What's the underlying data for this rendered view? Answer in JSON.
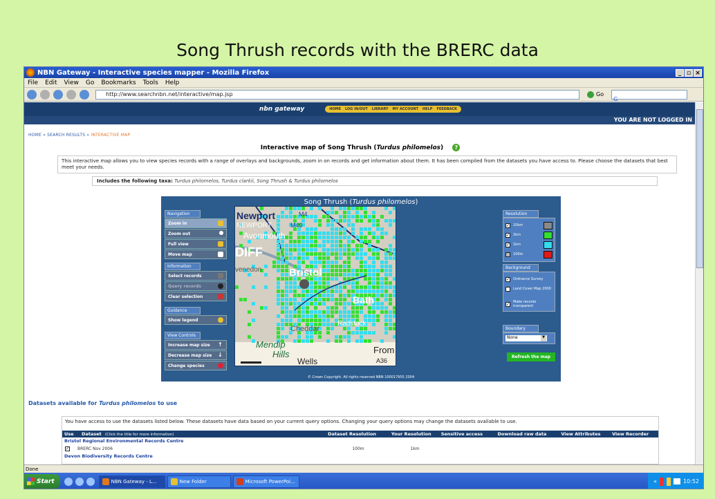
{
  "slide": {
    "title": "Song Thrush records with the BRERC data"
  },
  "window": {
    "title": "NBN Gateway - Interactive species mapper - Mozilla Firefox",
    "controls": [
      "_",
      "×"
    ],
    "menu": [
      "File",
      "Edit",
      "View",
      "Go",
      "Bookmarks",
      "Tools",
      "Help"
    ],
    "url": "http://www.searchnbn.net/interactive/map.jsp",
    "go_label": "Go",
    "search_label": "G"
  },
  "site": {
    "brand": "nbn gateway",
    "nav": [
      "HOME",
      "LOG IN/OUT",
      "LIBRARY",
      "MY ACCOUNT",
      "HELP",
      "FEEDBACK"
    ],
    "login_status": "YOU ARE NOT LOGGED IN"
  },
  "breadcrumb": {
    "home": "HOME",
    "results": "SEARCH RESULTS",
    "current": "INTERACTIVE MAP",
    "sep": " » "
  },
  "page": {
    "heading_prefix": "Interactive map of Song Thrush (",
    "heading_latin": "Turdus philomelos",
    "heading_suffix": ")",
    "help": "?",
    "description": "This interactive map allows you to view species records with a range of overlays and backgrounds, zoom in on records and get information about them. It has been compiled from the datasets you have access to. Please choose the datasets that best meet your needs.",
    "taxa_label": "Includes the following taxa:",
    "taxa_value": "Turdus philomelos, Turdus clarkii, Song Thrush & Turdus philomelos"
  },
  "map": {
    "title_common": "Song Thrush (",
    "title_latin": "Turdus philomelos",
    "title_close": ")",
    "footer": "© Crown Copyright. All rights reserved NBN 100017955 2004",
    "places": [
      "Newport",
      "NEWPORT",
      "M4",
      "M49",
      "Avonmouth",
      "DIFF",
      "venedon",
      "Bristol",
      "Bath",
      "Radstock",
      "Cheddar",
      "Mendip",
      "Hills",
      "Wells",
      "From",
      "A36"
    ],
    "groups": {
      "navigation": {
        "label": "Navigation",
        "buttons": [
          "Zoom in",
          "Zoom out",
          "Full view",
          "Move map"
        ]
      },
      "information": {
        "label": "Information",
        "buttons": [
          "Select records",
          "Query records",
          "Clear selection"
        ]
      },
      "guidance": {
        "label": "Guidance",
        "buttons": [
          "Show legend"
        ]
      },
      "view": {
        "label": "View Controls",
        "buttons": [
          "Increase map size",
          "Decrease map size",
          "Change species"
        ]
      }
    },
    "resolution": {
      "label": "Resolution",
      "rows": [
        {
          "label": "10km",
          "color": "#8a8a8a"
        },
        {
          "label": "2km",
          "color": "#33e033"
        },
        {
          "label": "1km",
          "color": "#33ddf0"
        },
        {
          "label": "100m",
          "color": "#e01818"
        }
      ]
    },
    "background": {
      "label": "Background",
      "rows": [
        "Ordnance Survey",
        "Land Cover Map 2000",
        "Make records transparent"
      ]
    },
    "boundary": {
      "label": "Boundary",
      "value": "None"
    },
    "refresh": "Refresh the map"
  },
  "datasets": {
    "heading_prefix": "Datasets available for ",
    "heading_latin": "Turdus philomelos",
    "heading_suffix": " to use",
    "note": "You have access to use the datasets listed below. These datasets have data based on your current query options. Changing your query options may change the datasets available to use.",
    "columns": [
      "Use",
      "Dataset",
      "Dataset Resolution",
      "Your Resolution",
      "Sensitive access",
      "Download raw data",
      "View Attributes",
      "View Recorder"
    ],
    "column_hint": "(Click the title for more information)",
    "providers": [
      {
        "name": "Bristol Regional Environmental Records Centre",
        "rows": [
          {
            "dataset": "BRERC Nov 2006",
            "dataset_res": "100m",
            "your_res": "1km"
          }
        ]
      },
      {
        "name": "Devon Biodiversity Records Centre",
        "rows": []
      }
    ]
  },
  "status": "Done",
  "taskbar": {
    "start": "Start",
    "tasks": [
      "NBN Gateway - L...",
      "New Folder",
      "Microsoft PowerPoi..."
    ],
    "time": "10:52",
    "tray_arrows": "«"
  }
}
